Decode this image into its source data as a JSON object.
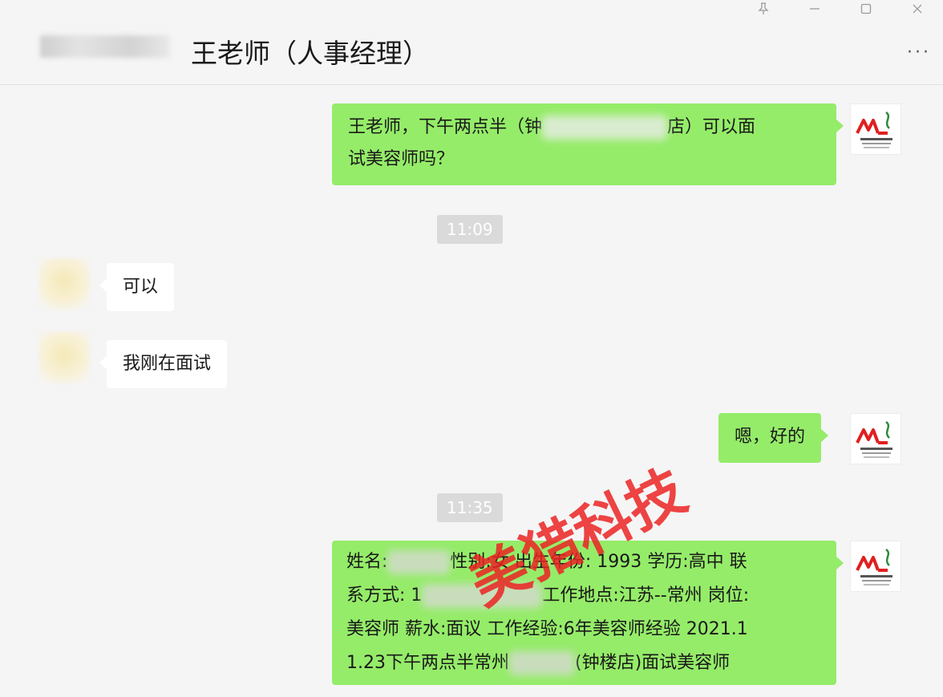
{
  "header": {
    "title": "王老师（人事经理）",
    "more_label": "···"
  },
  "window_controls": {
    "pin_icon": "pin-icon",
    "minimize_icon": "minimize-icon",
    "maximize_icon": "maximize-icon",
    "close_icon": "close-icon"
  },
  "messages": [
    {
      "direction": "out",
      "lines": [
        "王老师，下午两点半（钟",
        "店）可以面",
        "试美容师吗？"
      ]
    },
    {
      "type": "time",
      "text": "11:09"
    },
    {
      "direction": "in",
      "text": "可以"
    },
    {
      "direction": "in",
      "text": "我刚在面试"
    },
    {
      "direction": "out",
      "text": "嗯，好的"
    },
    {
      "type": "time",
      "text": "11:35"
    },
    {
      "direction": "out",
      "lines": [
        "姓名:",
        "性别:女 出生年份: 1993 学历:高中 联",
        "系方式: 1",
        "工作地点:江苏--常州 岗位:",
        "美容师 薪水:面议 工作经验:6年美容师经验 2021.1",
        "1.23下午两点半常州",
        "(钟楼店)面试美容师"
      ]
    }
  ],
  "watermark": "美猎科技",
  "self_avatar_logo": "ML",
  "colors": {
    "out_bubble": "#95ec69",
    "in_bubble": "#ffffff",
    "background": "#f5f5f5",
    "timestamp_bg": "#dadada",
    "watermark": "#eb2323"
  }
}
